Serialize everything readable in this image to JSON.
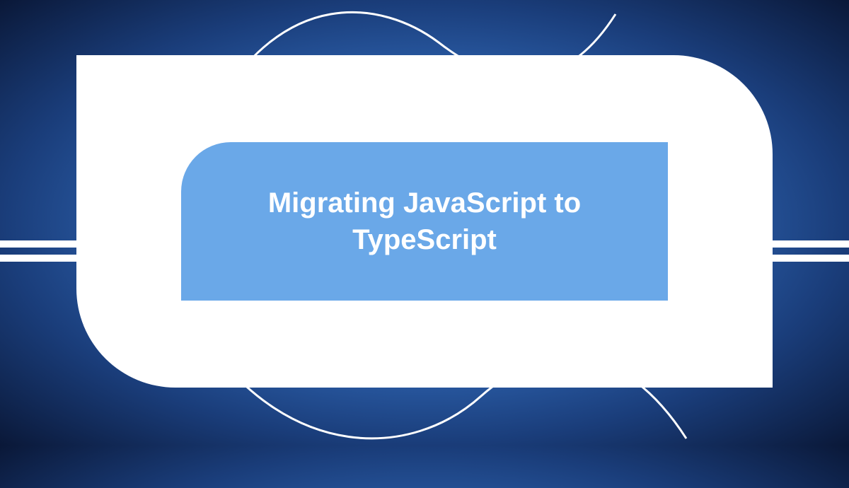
{
  "banner": {
    "title": "Migrating JavaScript to TypeScript"
  },
  "colors": {
    "inner_bg": "#6aa8e8",
    "outer_bg": "#ffffff",
    "text": "#ffffff"
  }
}
